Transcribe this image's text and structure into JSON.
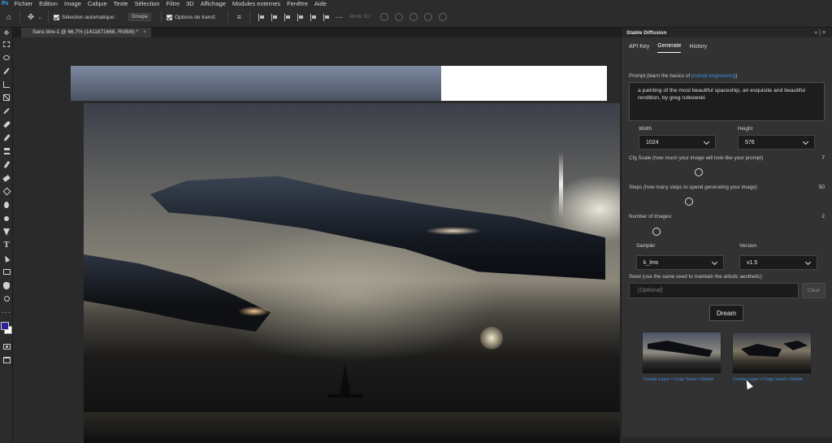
{
  "app": {
    "logo": "Ps",
    "menu": [
      "Fichier",
      "Edition",
      "Image",
      "Calque",
      "Texte",
      "Sélection",
      "Filtre",
      "3D",
      "Affichage",
      "Modules externes",
      "Fenêtre",
      "Aide"
    ]
  },
  "options_bar": {
    "auto_select_label": "Sélection automatique :",
    "auto_select_value": "Groupe",
    "transform_label": "Options de transf.",
    "mode_3d_label": "Mode 3D :"
  },
  "document": {
    "tab_title": "Sans titre-1 @ 66,7% (1411871668, RVB/8) *",
    "tab_close": "×"
  },
  "plugin": {
    "panel_title": "Stable Diffusion",
    "panel_controls": "»|≡",
    "tabs": [
      "API Key",
      "Generate",
      "History"
    ],
    "active_tab": "Generate",
    "prompt_label_prefix": "Prompt (learn the basics of ",
    "prompt_label_link": "prompt engineering",
    "prompt_label_suffix": ")",
    "prompt_text": "a painting of the most beautiful spaceship, an exquisite and beautiful rendition, by greg rutkowski",
    "width_label": "Width",
    "width_value": "1024",
    "height_label": "Height",
    "height_value": "576",
    "cfg_label": "Cfg Scale (how much your image will look like your prompt)",
    "cfg_value": "7",
    "cfg_level": 0.35,
    "steps_label": "Steps (how many steps to spend generating your image)",
    "steps_value": "50",
    "steps_level": 0.3,
    "images_label": "Number of Images:",
    "images_value": "2",
    "images_level": 0.14,
    "sampler_label": "Sampler",
    "sampler_value": "k_lms",
    "version_label": "Version",
    "version_value": "v1.5",
    "seed_label": "Seed (use the same seed to maintain the artistic aesthetic)",
    "seed_placeholder": "(Optional)",
    "clear_label": "Clear",
    "dream_label": "Dream",
    "result_actions": [
      {
        "create": "Create Layer",
        "copy": "Copy Seed",
        "delete": "Delete"
      },
      {
        "create": "Create Layer",
        "copy": "Copy Seed",
        "delete": "Delete"
      }
    ],
    "separator": " • "
  },
  "colors": {
    "foreground_swatch": "#2b1f9b",
    "background_swatch": "#ffffff",
    "link": "#3c8fe0"
  }
}
